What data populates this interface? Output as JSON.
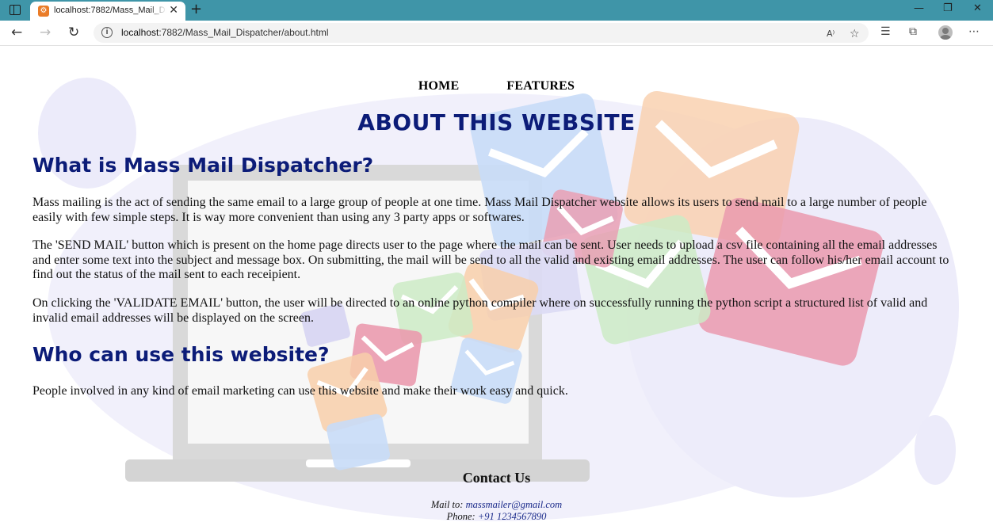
{
  "browser": {
    "tab_title": "localhost:7882/Mass_Mail_Dispatcher/about.html",
    "tab_favicon": "xampp",
    "url_host": "localhost",
    "url_rest": ":7882/Mass_Mail_Dispatcher/about.html",
    "new_tab": "+",
    "close": "✕"
  },
  "nav": {
    "home": "HOME",
    "features": "FEATURES"
  },
  "page_title": "ABOUT THIS WEBSITE",
  "section1": {
    "heading": "What is Mass Mail Dispatcher?",
    "p1": "Mass mailing is the act of sending the same email to a large group of people at one time. Mass Mail Dispatcher website allows its users to send mail to a large number of people easily with few simple steps. It is way more convenient than using any 3 party apps or softwares.",
    "p2": "The 'SEND MAIL' button which is present on the home page directs user to the page where the mail can be sent. User needs to upload a csv file containing all the email addresses and enter some text into the subject and message box. On submitting, the mail will be send to all the valid and existing email addresses. The user can follow his/her email account to find out the status of the mail sent to each receipient.",
    "p3": "On clicking the 'VALIDATE EMAIL' button, the user will be directed to an online python compiler where on successfully running the python script a structured list of valid and invalid email addresses will be displayed on the screen."
  },
  "section2": {
    "heading": "Who can use this website?",
    "p1": "People involved in any kind of email marketing can use this website and make their work easy and quick."
  },
  "contact": {
    "title": "Contact Us",
    "mail_label": "Mail to: ",
    "mail_value": "massmailer@gmail.com",
    "phone_label": "Phone: ",
    "phone_value": "+91 1234567890"
  },
  "colors": {
    "heading": "#0c1c78",
    "tabstrip": "#3f95a8"
  }
}
